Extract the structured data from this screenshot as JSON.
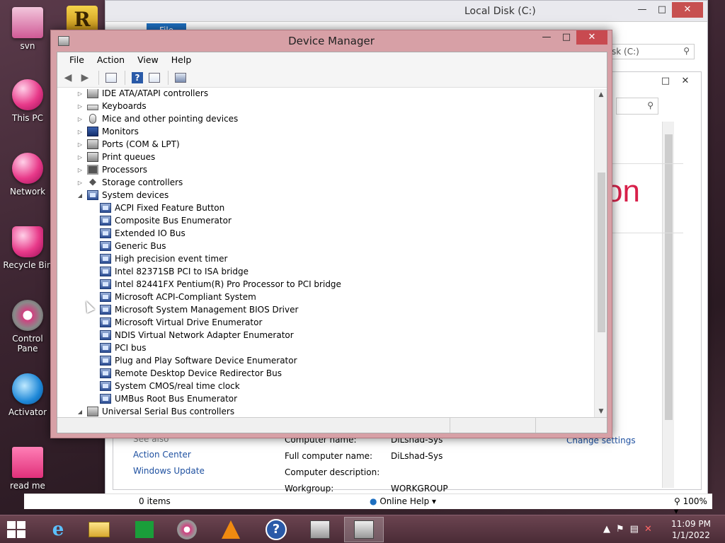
{
  "desktop": {
    "icons": [
      {
        "label": "svn",
        "icon": "svn-icon"
      },
      {
        "label": "This PC",
        "icon": "this-pc-icon"
      },
      {
        "label": "Network",
        "icon": "network-icon"
      },
      {
        "label": "Recycle Bin",
        "icon": "recycle-bin-icon"
      },
      {
        "label": "Control Pane",
        "icon": "control-panel-icon"
      },
      {
        "label": "Activator",
        "icon": "internet-explorer-icon"
      },
      {
        "label": "read me",
        "icon": "text-file-icon"
      }
    ],
    "r_icon_letter": "R"
  },
  "background_window": {
    "title": "Local Disk (C:)",
    "ribbon_file": "File",
    "search_placeholder": "sk (C:)",
    "red_fragment": "on",
    "items_count": "0 items",
    "online_help": "Online Help",
    "zoom": "100%",
    "see_also": "See also",
    "links": [
      "Action Center",
      "Windows Update"
    ],
    "change_settings": "Change settings",
    "labels": {
      "computer_name": "Computer name:",
      "full_computer_name": "Full computer name:",
      "computer_description": "Computer description:",
      "workgroup": "Workgroup:"
    },
    "values": {
      "computer_name": "DiLshad-Sys",
      "full_computer_name": "DiLshad-Sys",
      "workgroup": "WORKGROUP"
    }
  },
  "device_manager": {
    "title": "Device Manager",
    "menu": [
      "File",
      "Action",
      "View",
      "Help"
    ],
    "tree": [
      {
        "label": "IDE ATA/ATAPI controllers",
        "level": 0,
        "expanded": false,
        "icon": "gray"
      },
      {
        "label": "Keyboards",
        "level": 0,
        "expanded": false,
        "icon": "kb"
      },
      {
        "label": "Mice and other pointing devices",
        "level": 0,
        "expanded": false,
        "icon": "mouse"
      },
      {
        "label": "Monitors",
        "level": 0,
        "expanded": false,
        "icon": "mon"
      },
      {
        "label": "Ports (COM & LPT)",
        "level": 0,
        "expanded": false,
        "icon": "print"
      },
      {
        "label": "Print queues",
        "level": 0,
        "expanded": false,
        "icon": "print"
      },
      {
        "label": "Processors",
        "level": 0,
        "expanded": false,
        "icon": "cpu"
      },
      {
        "label": "Storage controllers",
        "level": 0,
        "expanded": false,
        "icon": "stor"
      },
      {
        "label": "System devices",
        "level": 0,
        "expanded": true,
        "icon": "chip"
      },
      {
        "label": "ACPI Fixed Feature Button",
        "level": 1,
        "icon": "chip"
      },
      {
        "label": "Composite Bus Enumerator",
        "level": 1,
        "icon": "chip"
      },
      {
        "label": "Extended IO Bus",
        "level": 1,
        "icon": "chip"
      },
      {
        "label": "Generic Bus",
        "level": 1,
        "icon": "chip"
      },
      {
        "label": "High precision event timer",
        "level": 1,
        "icon": "chip"
      },
      {
        "label": "Intel 82371SB PCI to ISA bridge",
        "level": 1,
        "icon": "chip"
      },
      {
        "label": "Intel 82441FX Pentium(R) Pro Processor to PCI bridge",
        "level": 1,
        "icon": "chip"
      },
      {
        "label": "Microsoft ACPI-Compliant System",
        "level": 1,
        "icon": "chip"
      },
      {
        "label": "Microsoft System Management BIOS Driver",
        "level": 1,
        "icon": "chip"
      },
      {
        "label": "Microsoft Virtual Drive Enumerator",
        "level": 1,
        "icon": "chip"
      },
      {
        "label": "NDIS Virtual Network Adapter Enumerator",
        "level": 1,
        "icon": "chip"
      },
      {
        "label": "PCI bus",
        "level": 1,
        "icon": "chip"
      },
      {
        "label": "Plug and Play Software Device Enumerator",
        "level": 1,
        "icon": "chip"
      },
      {
        "label": "Remote Desktop Device Redirector Bus",
        "level": 1,
        "icon": "chip"
      },
      {
        "label": "System CMOS/real time clock",
        "level": 1,
        "icon": "chip"
      },
      {
        "label": "UMBus Root Bus Enumerator",
        "level": 1,
        "icon": "chip"
      },
      {
        "label": "Universal Serial Bus controllers",
        "level": 0,
        "expanded": true,
        "icon": "gray"
      }
    ]
  },
  "taskbar": {
    "apps": [
      "internet-explorer-icon",
      "file-explorer-icon",
      "store-icon",
      "media-icon",
      "vlc-icon",
      "help-icon",
      "device-manager-icon",
      "device-manager-active-icon"
    ],
    "time": "11:09 PM",
    "date": "1/1/2022"
  },
  "colors": {
    "dm_frame": "#d7a0a6",
    "close_button": "#c84a50",
    "link": "#1e50a0",
    "accent_red": "#d8204a"
  }
}
